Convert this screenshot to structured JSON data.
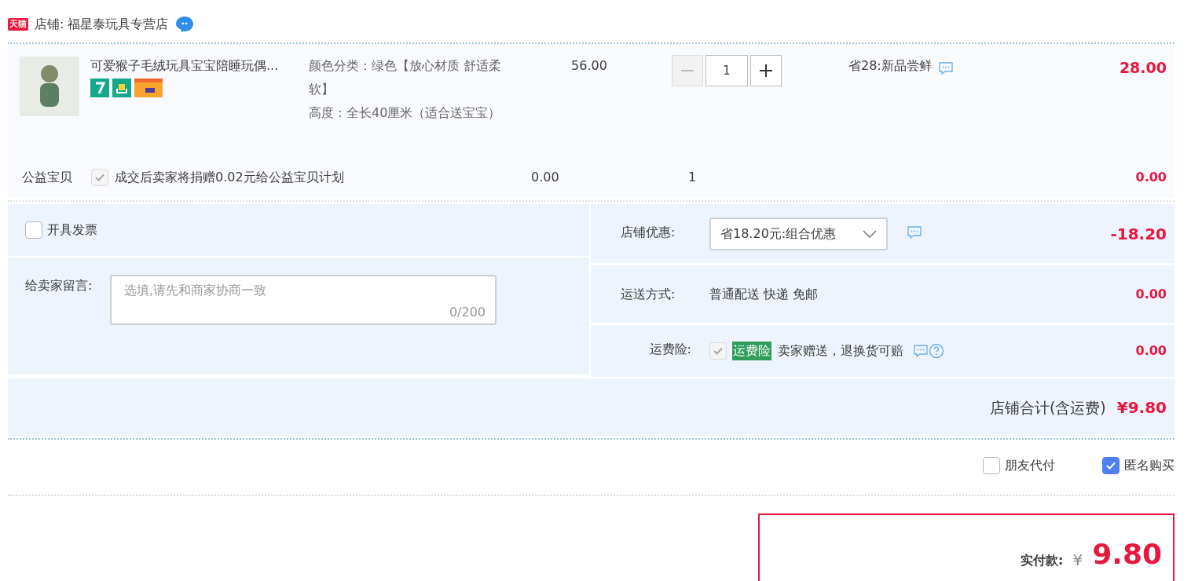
{
  "store": {
    "badge": "天猫",
    "label": "店铺: 福星泰玩具专营店"
  },
  "item": {
    "title": "可爱猴子毛绒玩具宝宝陪睡玩偶...",
    "attributes": [
      "颜色分类：绿色【放心材质 舒适柔软】",
      "高度：全长40厘米（适合送宝宝）"
    ],
    "price": "56.00",
    "quantity": "1",
    "promo": "省28:新品尝鲜",
    "subtotal": "28.00"
  },
  "charity": {
    "label": "公益宝贝",
    "checked": true,
    "disabled": true,
    "text": "成交后卖家将捐赠0.02元给公益宝贝计划",
    "price": "0.00",
    "quantity": "1",
    "subtotal": "0.00"
  },
  "invoice": {
    "label": "开具发票",
    "checked": false
  },
  "message": {
    "label": "给卖家留言:",
    "placeholder": "选填,请先和商家协商一致",
    "counter": "0/200"
  },
  "discount": {
    "label": "店铺优惠:",
    "value": "省18.20元:组合优惠",
    "amount": "-18.20"
  },
  "shipping": {
    "label": "运送方式:",
    "value": "普通配送 快递 免邮",
    "amount": "0.00"
  },
  "insurance": {
    "label": "运费险:",
    "checked": true,
    "disabled": true,
    "tag": "运费险",
    "text": "卖家赠送，退换货可赔",
    "amount": "0.00"
  },
  "total": {
    "label": "店铺合计(含运费)",
    "amount": "¥9.80"
  },
  "options": [
    {
      "label": "朋友代付",
      "checked": false
    },
    {
      "label": "匿名购买",
      "checked": true
    }
  ],
  "payment": {
    "label": "实付款:",
    "currency": "¥",
    "amount": "9.80"
  }
}
